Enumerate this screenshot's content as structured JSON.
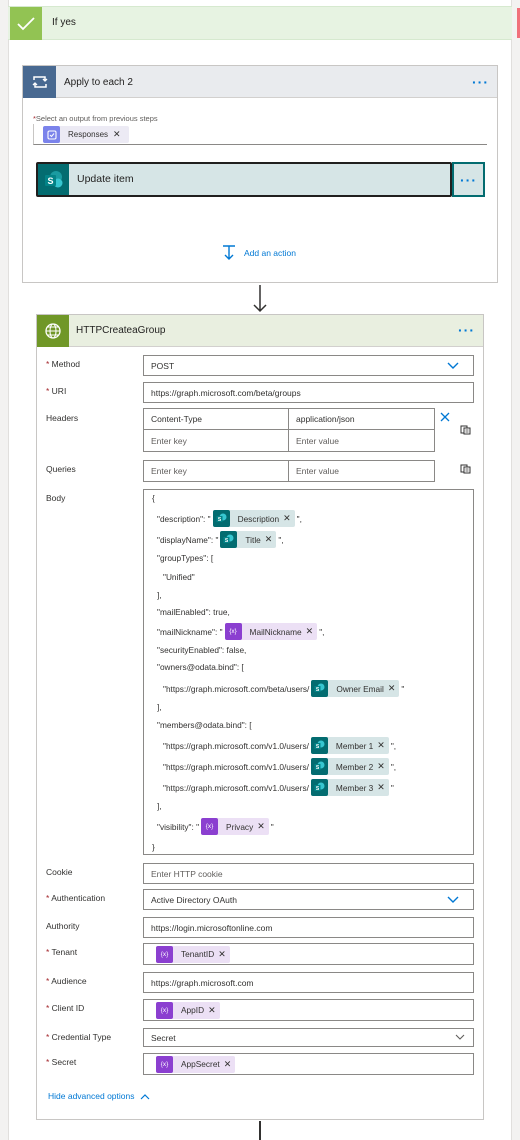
{
  "branch": {
    "title": "If yes"
  },
  "apply_each": {
    "title": "Apply to each 2",
    "select_label": "Select an output from previous steps",
    "token": "Responses",
    "inner_action": "Update item",
    "add_action": "Add an action"
  },
  "http": {
    "title": "HTTPCreateaGroup",
    "fields": {
      "method": {
        "label": "Method",
        "value": "POST"
      },
      "uri": {
        "label": "URI",
        "value": "https://graph.microsoft.com/beta/groups"
      },
      "headers": {
        "label": "Headers",
        "key": "Content-Type",
        "value": "application/json",
        "key_placeholder": "Enter key",
        "value_placeholder": "Enter value"
      },
      "queries": {
        "label": "Queries",
        "key_placeholder": "Enter key",
        "value_placeholder": "Enter value"
      },
      "body": {
        "label": "Body"
      },
      "cookie": {
        "label": "Cookie",
        "placeholder": "Enter HTTP cookie"
      },
      "authentication": {
        "label": "Authentication",
        "value": "Active Directory OAuth"
      },
      "authority": {
        "label": "Authority",
        "value": "https://login.microsoftonline.com"
      },
      "tenant": {
        "label": "Tenant",
        "token": "TenantID"
      },
      "audience": {
        "label": "Audience",
        "value": "https://graph.microsoft.com"
      },
      "client_id": {
        "label": "Client ID",
        "token": "AppID"
      },
      "credential_type": {
        "label": "Credential Type",
        "value": "Secret"
      },
      "secret": {
        "label": "Secret",
        "token": "AppSecret"
      }
    },
    "body_lines": {
      "l1": "{",
      "l2a": "\"description\": \"",
      "l2tok": "Description",
      "l2b": "\",",
      "l3a": "\"displayName\": \"",
      "l3tok": "Title",
      "l3b": "\",",
      "l4": "\"groupTypes\": [",
      "l5": "\"Unified\"",
      "l6": "],",
      "l7": "\"mailEnabled\": true,",
      "l8a": "\"mailNickname\": \"",
      "l8tok": "MailNickname",
      "l8b": "\",",
      "l9": "\"securityEnabled\": false,",
      "l10": "\"owners@odata.bind\": [",
      "l11a": "\"https://graph.microsoft.com/beta/users/",
      "l11tok": "Owner Email",
      "l11b": "\"",
      "l12": "],",
      "l13": "\"members@odata.bind\": [",
      "l14a": "\"https://graph.microsoft.com/v1.0/users/",
      "l14tok": "Member 1",
      "l14b": "\",",
      "l15a": "\"https://graph.microsoft.com/v1.0/users/",
      "l15tok": "Member 2",
      "l15b": "\",",
      "l16a": "\"https://graph.microsoft.com/v1.0/users/",
      "l16tok": "Member 3",
      "l16b": "\"",
      "l17": "],",
      "l18a": "\"visibility\": \"",
      "l18tok": "Privacy",
      "l18b": "\"",
      "l19": "}"
    },
    "hide_advanced": "Hide advanced options"
  },
  "colors": {
    "accent": "#0078d4",
    "condition_green": "#92c353",
    "loop_blue": "#486991",
    "sharepoint_teal": "#036c70",
    "http_green": "#709727",
    "expression_purple": "#8b3fd0",
    "required_red": "#a4262c"
  },
  "icons": {
    "branch": "check-icon",
    "loop": "loop-icon",
    "sharepoint": "sharepoint-icon",
    "http": "globe-icon",
    "expression": "expression-icon",
    "forms": "forms-icon"
  }
}
